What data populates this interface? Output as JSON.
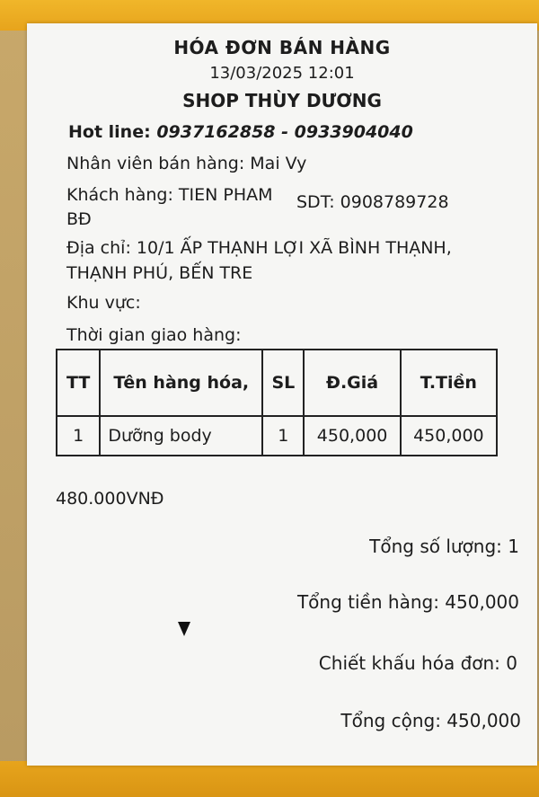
{
  "receipt": {
    "title": "HÓA ĐƠN BÁN HÀNG",
    "datetime": "13/03/2025 12:01",
    "shop_name": "SHOP THÙY DƯƠNG",
    "hotline_label": "Hot line: ",
    "hotline_numbers": "0937162858 - 0933904040",
    "staff": "Nhân viên bán hàng: Mai Vy",
    "customer": "Khách hàng: TIEN PHAM BĐ",
    "phone": "SDT: 0908789728",
    "address": "Địa chỉ: 10/1 ẤP THẠNH LỢI XÃ BÌNH THẠNH, THẠNH PHÚ, BẾN TRE",
    "area": "Khu vực:",
    "delivery_time": "Thời gian giao hàng:",
    "table": {
      "headers": [
        "TT",
        "Tên hàng hóa,",
        "SL",
        "Đ.Giá",
        "T.Tiền"
      ],
      "rows": [
        [
          "1",
          "Dưỡng body",
          "1",
          "450,000",
          "450,000"
        ]
      ]
    },
    "total_text": "480.000VNĐ",
    "total_quantity": "Tổng số lượng: 1",
    "goods_total": "Tổng tiền hàng: 450,000",
    "discount": "Chiết khấu hóa đơn: 0",
    "grand_total": "Tổng cộng: 450,000"
  },
  "colors": {
    "tape": "#e7a41c",
    "paper": "#f6f6f4",
    "ink": "#1d1d1d",
    "cardboard": "#c8a86a"
  }
}
